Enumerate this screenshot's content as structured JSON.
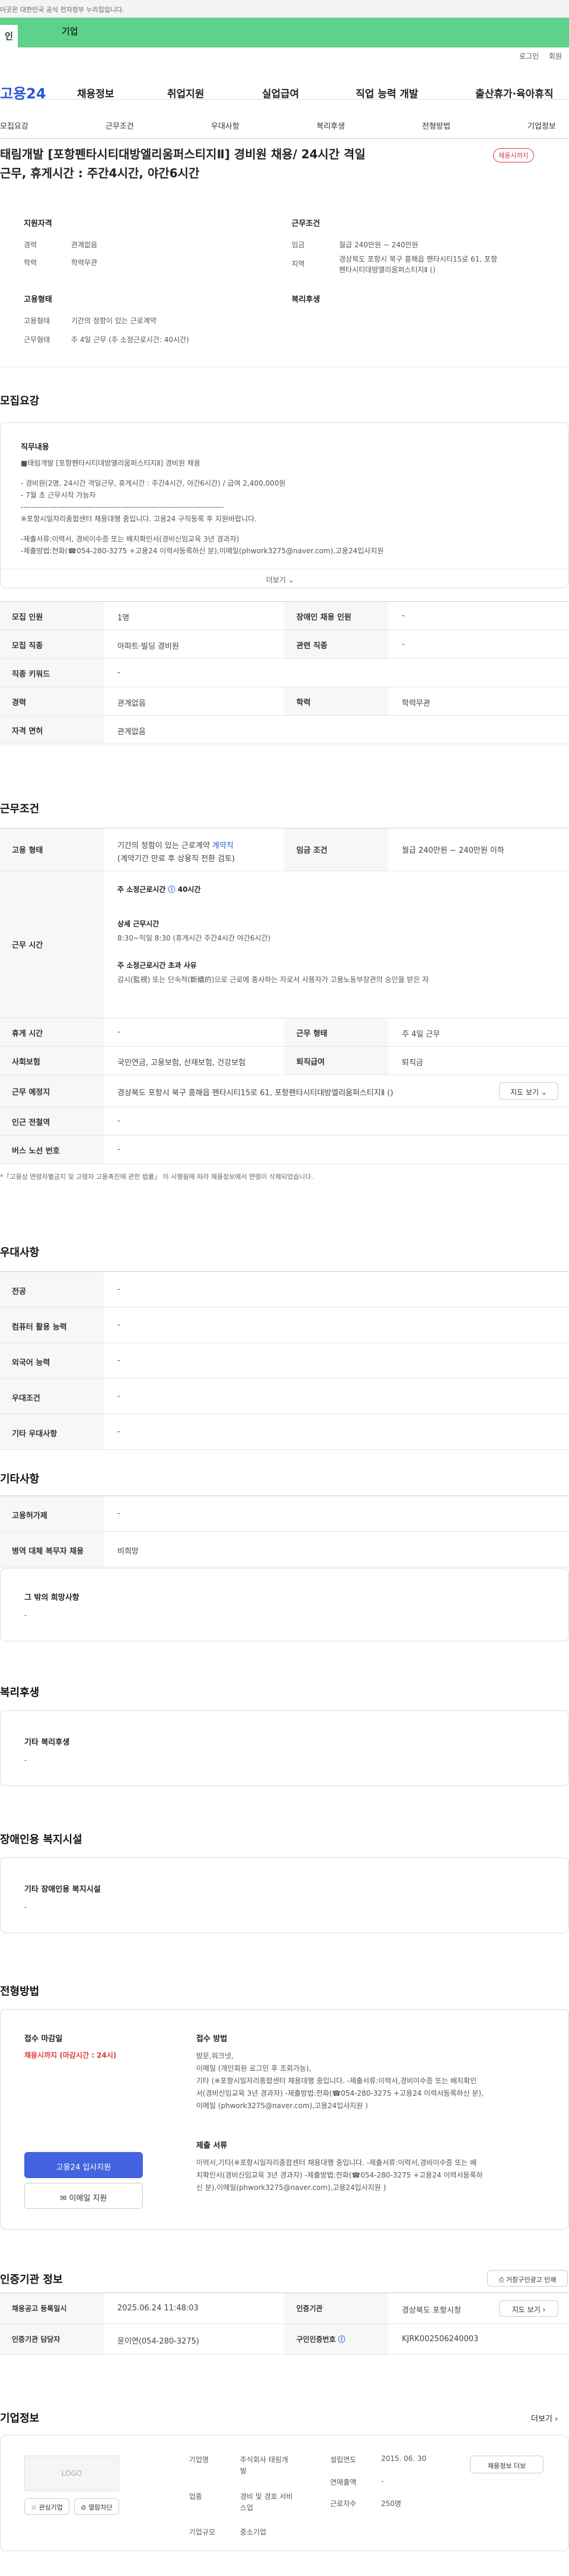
{
  "topbar": {
    "notice": "이곳은 대한민국 공식 전자정부 누리집입니다."
  },
  "tabs": [
    "인",
    "기업"
  ],
  "util": [
    "로그인",
    "회원"
  ],
  "gnb": {
    "logo": "고용24",
    "items": [
      "채용정보",
      "취업지원",
      "실업급여",
      "직업 능력 개발",
      "출산휴가·육아휴직"
    ]
  },
  "subnav": [
    "모집요강",
    "근무조건",
    "우대사항",
    "복리후생",
    "전형방법",
    "기업정보"
  ],
  "header": {
    "title_line1": "태림개발 [포항펜타시티대방엘리움퍼스티지Ⅱ] 경비원 채용/ 24시간 격일",
    "title_line2": "근무, 휴게시간 : 주간4시간, 야간6시간",
    "badge": "채용시까지"
  },
  "summary": {
    "qual_title": "지원자격",
    "exp_lbl": "경력",
    "exp_val": "관계없음",
    "edu_lbl": "학력",
    "edu_val": "학력무관",
    "work_title": "근무조건",
    "pay_lbl": "임금",
    "pay_val": "월급 240만원 ~ 240만원",
    "loc_lbl": "지역",
    "loc_val1": "경상북도 포항시 북구 흥해읍 펜타시티15로 61, 포항",
    "loc_val2": "펜타시티대방엘리움퍼스티지Ⅱ ()",
    "emp_title": "고용형태",
    "emp_lbl": "고용형태",
    "emp_val": "기간의 정함이 있는 근로계약",
    "hours_lbl": "근무형태",
    "hours_val": "주 4일 근무 (주 소정근로시간: 40시간)",
    "welfare_title": "복리후생"
  },
  "recruit": {
    "title": "모집요강",
    "duty_title": "직무내용",
    "duty_lines": [
      "■태림개발 [포항펜타시티대방엘리움퍼스티지Ⅱ] 경비원 채용",
      "",
      "- 경비원(2명, 24시간 격일근무, 휴게시간 : 주간4시간, 야간6시간) / 급여 2,400,000원",
      "- 7월 초 근무시작 가능자",
      "-------------------------------------------------------------------------------",
      "※포항시일자리종합센터 채용대행 중입니다. 고용24 구직등록 후 지원바랍니다.",
      "",
      "-제출서류:이력서, 경비이수증 또는 배치확인서(경비신임교육 3년 경과자)",
      "-제출방법:전화(☎054-280-3275 +고용24 이력서등록하신 분),이메일(phwork3275@naver.com),고용24입사지원"
    ],
    "more": "더보기",
    "rows": [
      {
        "l1": "모집 인원",
        "v1": "1명",
        "l2": "장애인 채용 인원",
        "v2": "-"
      },
      {
        "l1": "모집 직종",
        "v1": "아파트·빌딩 경비원",
        "l2": "관련 직종",
        "v2": "-"
      },
      {
        "l1": "직종 키워드",
        "v1": "-"
      },
      {
        "l1": "경력",
        "v1": "관계없음",
        "l2": "학력",
        "v2": "학력무관"
      },
      {
        "l1": "자격 면허",
        "v1": "관계없음"
      }
    ]
  },
  "work": {
    "title": "근무조건",
    "emp_lbl": "고용 형태",
    "emp_val1": "기간의 정함이 있는 근로계약",
    "emp_link": " 계약직",
    "emp_val2": "(계약기간 만료 후 상용직 전환 검토)",
    "pay_lbl": "임금 조건",
    "pay_val": "월급 240만원 ~ 240만원 이하",
    "time_lbl": "근무 시간",
    "time_h1": "주 소정근로시간",
    "time_h1v": "40시간",
    "time_h2": "상세 근무시간",
    "time_v2": "8:30~익일 8:30 (휴게시간 주간4시간 야간6시간)",
    "time_h3": "주 소정근로시간 초과 사유",
    "time_v3": "감시(監視) 또는 단속적(斷續的)으로 근로에 종사하는 자로서 사용자가 고용노동부장관의 승인을 받은 자",
    "rest_lbl": "휴게 시간",
    "rest_val": "-",
    "type_lbl": "근무 형태",
    "type_val": "주 4일 근무",
    "ins_lbl": "사회보험",
    "ins_val": "국민연금, 고용보험, 산재보험, 건강보험",
    "ret_lbl": "퇴직급여",
    "ret_val": "퇴직금",
    "place_lbl": "근무 예정지",
    "place_val": "경상북도 포항시 북구 흥해읍 펜타시티15로 61, 포항펜타시티대방엘리움퍼스티지Ⅱ ()",
    "map_btn": "지도 보기",
    "subway_lbl": "인근 전철역",
    "subway_val": "-",
    "bus_lbl": "버스 노선 번호",
    "bus_val": "-",
    "note": "*「고용상 연령차별금지 및 고령자 고용촉진에 관한 법률」 이 시행됨에 따라 채용정보에서 연령이 삭제되었습니다."
  },
  "pref": {
    "title": "우대사항",
    "rows": [
      {
        "l": "전공",
        "v": "-"
      },
      {
        "l": "컴퓨터 활용 능력",
        "v": "-"
      },
      {
        "l": "외국어 능력",
        "v": "-"
      },
      {
        "l": "우대조건",
        "v": "-"
      },
      {
        "l": "기타 우대사항",
        "v": "-"
      }
    ]
  },
  "etc": {
    "title": "기타사항",
    "rows": [
      {
        "l": "고용허가제",
        "v": "-"
      },
      {
        "l": "병역 대체 복무자 채용",
        "v": "비희망"
      }
    ],
    "wish_title": "그 밖의 희망사항",
    "wish_val": "-"
  },
  "welfare": {
    "title": "복리후생",
    "sub": "기타 복리후생",
    "val": "-"
  },
  "disabled": {
    "title": "장애인용 복지시설",
    "sub": "기타 장애인용 복지시설",
    "val": "-"
  },
  "apply": {
    "title": "전형방법",
    "deadline_title": "접수 마감일",
    "deadline_val": "채용시까지 (마감시간 : 24시)",
    "apply_btn": "고용24 입사지원",
    "mail_btn": "이메일 지원",
    "method_title": "접수 방법",
    "method_lines": [
      "방문,워크넷,",
      "이메일 (개인회원 로그인 후 조회가능),",
      "기타 (※포항시일자리종합센터 채용대행 중입니다. -제출서류:이력서,경비이수증 또는 배치확인",
      "서(경비신임교육 3년 경과자) -제출방법:전화(☎054-280-3275 +고용24 이력서등록하신 분),",
      "이메일 (phwork3275@naver.com),고용24입사지원 )"
    ],
    "doc_title": "제출 서류",
    "doc_lines": [
      "이력서,기타(※포항시일자리종합센터 채용대행 중입니다. -제출서류:이력서,경비이수증 또는 배",
      "치확인서(경비신임교육 3년 경과자) -제출방법:전화(☎054-280-3275 +고용24 이력서등록하",
      "신 분),이메일(phwork3275@naver.com),고용24입사지원 )"
    ]
  },
  "agency": {
    "title": "인증기관 정보",
    "print_btn": "거창구인광고 인쇄",
    "reg_lbl": "채용공고 등록일시",
    "reg_val": "2025.06.24 11:48:03",
    "org_lbl": "인증기관",
    "org_val": "경상북도 포항시청",
    "map_btn": "지도 보기",
    "mgr_lbl": "인증기관 담당자",
    "mgr_val": "윤이연(054-280-3275)",
    "id_lbl": "구인인증번호",
    "id_val": "KJRK002506240003"
  },
  "company": {
    "title": "기업정보",
    "more": "더보기",
    "logo": "LOGO",
    "fav_btn": "관심기업",
    "block_btn": "열람차단",
    "name_lbl": "기업명",
    "name_val1": "주식회사 태림개",
    "name_val2": "발",
    "biz_lbl": "업종",
    "biz_val1": "경비 및 경호 서비",
    "biz_val2": "스업",
    "scale_lbl": "기업규모",
    "scale_val": "중소기업",
    "est_lbl": "설립연도",
    "est_val": "2015. 06. 30",
    "sales_lbl": "연매출액",
    "sales_val": "-",
    "emp_lbl": "근로자수",
    "emp_val": "250명",
    "detail_btn": "채용정보 더보"
  }
}
